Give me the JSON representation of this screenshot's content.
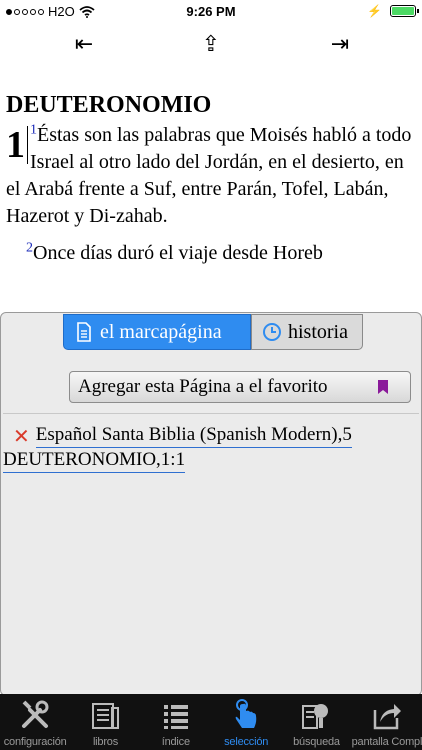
{
  "status_bar": {
    "carrier": "H2O",
    "time": "9:26 PM"
  },
  "nav": {
    "prev_symbol": "⇤",
    "up_symbol": "⇪",
    "next_symbol": "⇥"
  },
  "reader": {
    "book_title": "DEUTERONOMIO",
    "chapter": "1",
    "verses": [
      {
        "num": "1",
        "text": "Éstas son las palabras que Moisés habló a todo Israel al otro lado del Jordán, en el desierto, en el Arabá frente a Suf, entre Parán, Tofel, Labán, Hazerot y Di-zahab."
      },
      {
        "num": "2",
        "text": "Once días duró el viaje desde Horeb"
      }
    ]
  },
  "panel": {
    "tabs": [
      {
        "label": "el marcapágina",
        "icon": "bookmark-page-icon",
        "active": true
      },
      {
        "label": "historia",
        "icon": "clock-icon",
        "active": false
      }
    ],
    "add_favorite_label": "Agregar esta Página a el favorito",
    "bookmarks": [
      {
        "line1": "Español Santa Biblia (Spanish Modern),5",
        "line2": "DEUTERONOMIO,1:1"
      }
    ]
  },
  "tabbar": {
    "items": [
      {
        "label": "configuración",
        "icon": "tools-icon"
      },
      {
        "label": "libros",
        "icon": "books-icon"
      },
      {
        "label": "índice",
        "icon": "list-icon"
      },
      {
        "label": "selección",
        "icon": "tap-hand-icon",
        "active": true
      },
      {
        "label": "búsqueda",
        "icon": "search-icon"
      },
      {
        "label": "pantalla Completa",
        "icon": "share-icon"
      }
    ]
  },
  "colors": {
    "accent": "#2f8cf0",
    "verse_number": "#1a2ab8",
    "delete": "#d93a2a",
    "battery": "#4cd964",
    "bookmark_ribbon": "#8a1a9a"
  }
}
